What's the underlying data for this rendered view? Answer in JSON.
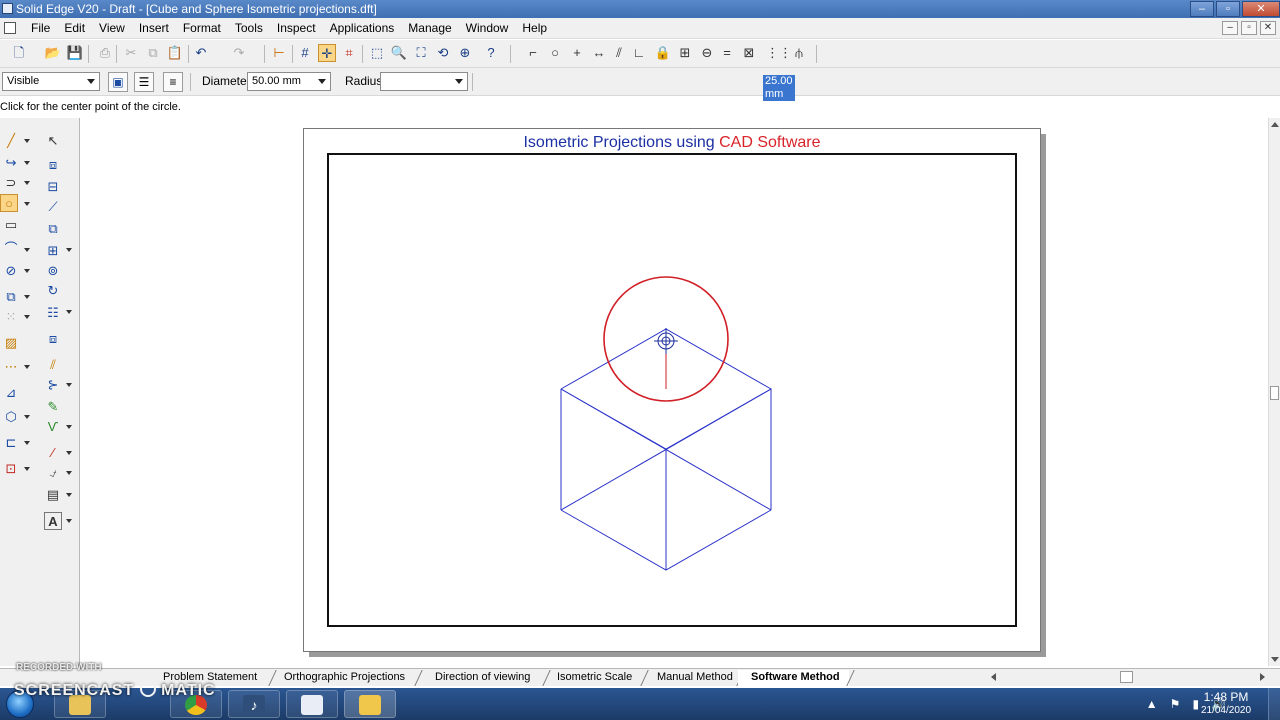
{
  "window": {
    "title": "Solid Edge V20 - Draft - [Cube and Sphere Isometric projections.dft]",
    "controls": [
      "–",
      "▫",
      "✕"
    ]
  },
  "menu": {
    "items": [
      "File",
      "Edit",
      "View",
      "Insert",
      "Format",
      "Tools",
      "Inspect",
      "Applications",
      "Manage",
      "Window",
      "Help"
    ],
    "mdi_controls": [
      "–",
      "▫",
      "✕"
    ]
  },
  "toolbar": {
    "icons": [
      "new-icon",
      "open-icon",
      "save-icon",
      "cut-icon",
      "copy-icon",
      "paste-icon",
      "undo-icon",
      "redo-icon",
      "grid-icon",
      "snap-icon",
      "zoom-area-icon",
      "zoom-icon",
      "fit-icon",
      "pan-icon",
      "help-icon",
      "line-icon",
      "circle-icon",
      "point-icon",
      "dimension-icon",
      "parallel-icon",
      "angle-icon",
      "lock-icon",
      "relationship-icon",
      "equal-icon",
      "symmetric-icon",
      "relations-icon"
    ]
  },
  "ribbon": {
    "linetype": "Visible",
    "diameter_label": "Diameter:",
    "diameter_value": "50.00 mm",
    "radius_label": "Radius:",
    "radius_value": "25.00 mm"
  },
  "prompt": "Click for the center point of the circle.",
  "sheet": {
    "title_part1": "Isometric Projections using",
    "title_part2": "CAD Software",
    "colors": {
      "title_blue": "#1c2fa4",
      "title_red": "#d8242a",
      "cube": "#2b33c9",
      "circle": "#d11f26"
    }
  },
  "tabs": [
    {
      "label": "Problem Statement",
      "active": false
    },
    {
      "label": "Orthographic Projections",
      "active": false
    },
    {
      "label": "Direction of viewing",
      "active": false
    },
    {
      "label": "Isometric Scale",
      "active": false
    },
    {
      "label": "Manual Method",
      "active": false
    },
    {
      "label": "Software Method",
      "active": true
    }
  ],
  "watermark": {
    "line1": "RECORDED WITH",
    "line2": "SCREENCAST",
    "line3": "MATIC"
  },
  "taskbar": {
    "time": "1:48 PM",
    "date": "21/04/2020",
    "tray_icons": [
      "▲",
      "⚑",
      "▮",
      "🔊"
    ]
  }
}
